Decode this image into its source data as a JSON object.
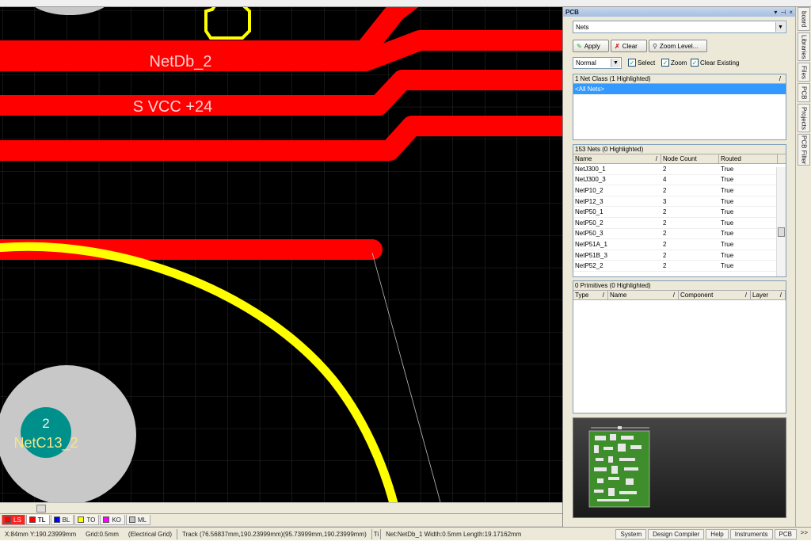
{
  "canvas": {
    "labels": {
      "net_db2": "NetDb_2",
      "svcc": "S VCC +24",
      "pad_number": "2",
      "pad_net": "NetC13_2"
    }
  },
  "layer_tabs": [
    {
      "label": "LS",
      "color": "#ff0000"
    },
    {
      "label": "TL",
      "color": "#ff0000"
    },
    {
      "label": "BL",
      "color": "#0000ff"
    },
    {
      "label": "TO",
      "color": "#ffff00"
    },
    {
      "label": "KO",
      "color": "#ff00ff"
    },
    {
      "label": "ML",
      "color": "#c0c0c0"
    }
  ],
  "status": {
    "coords": "X:84mm Y:190.23999mm",
    "grid": "Grid:0.5mm",
    "grid_type": "(Electrical Grid)",
    "track": "Track (76.56837mm,190.23999mm)(95.73999mm,190.23999mm)",
    "track_extra": "Ti",
    "net_info": "Net:NetDb_1 Width:0.5mm Length:19.17162mm",
    "buttons": [
      "System",
      "Design Compiler",
      "Help",
      "Instruments",
      "PCB"
    ],
    "more": ">>"
  },
  "panel": {
    "title": "PCB",
    "mode": "Nets",
    "apply": "Apply",
    "clear": "Clear",
    "zoom_level": "Zoom Level...",
    "mask_mode": "Normal",
    "select": "Select",
    "zoom": "Zoom",
    "clear_existing": "Clear Existing",
    "classes_header": "1 Net Class (1 Highlighted)",
    "classes_item": "<All Nets>",
    "nets_header": "153 Nets (0 Highlighted)",
    "nets_columns": [
      "Name",
      "Node Count",
      "Routed"
    ],
    "nets": [
      [
        "NetJ300_1",
        "2",
        "True"
      ],
      [
        "NetJ300_3",
        "4",
        "True"
      ],
      [
        "NetP10_2",
        "2",
        "True"
      ],
      [
        "NetP12_3",
        "3",
        "True"
      ],
      [
        "NetP50_1",
        "2",
        "True"
      ],
      [
        "NetP50_2",
        "2",
        "True"
      ],
      [
        "NetP50_3",
        "2",
        "True"
      ],
      [
        "NetP51A_1",
        "2",
        "True"
      ],
      [
        "NetP51B_3",
        "2",
        "True"
      ],
      [
        "NetP52_2",
        "2",
        "True"
      ]
    ],
    "prims_header": "0 Primitives (0 Highlighted)",
    "prims_columns": [
      "Type",
      "Name",
      "Component",
      "Layer"
    ]
  },
  "side_tabs": [
    "board",
    "Libraries",
    "Files",
    "PCB",
    "Projects",
    "PCB Filter"
  ]
}
